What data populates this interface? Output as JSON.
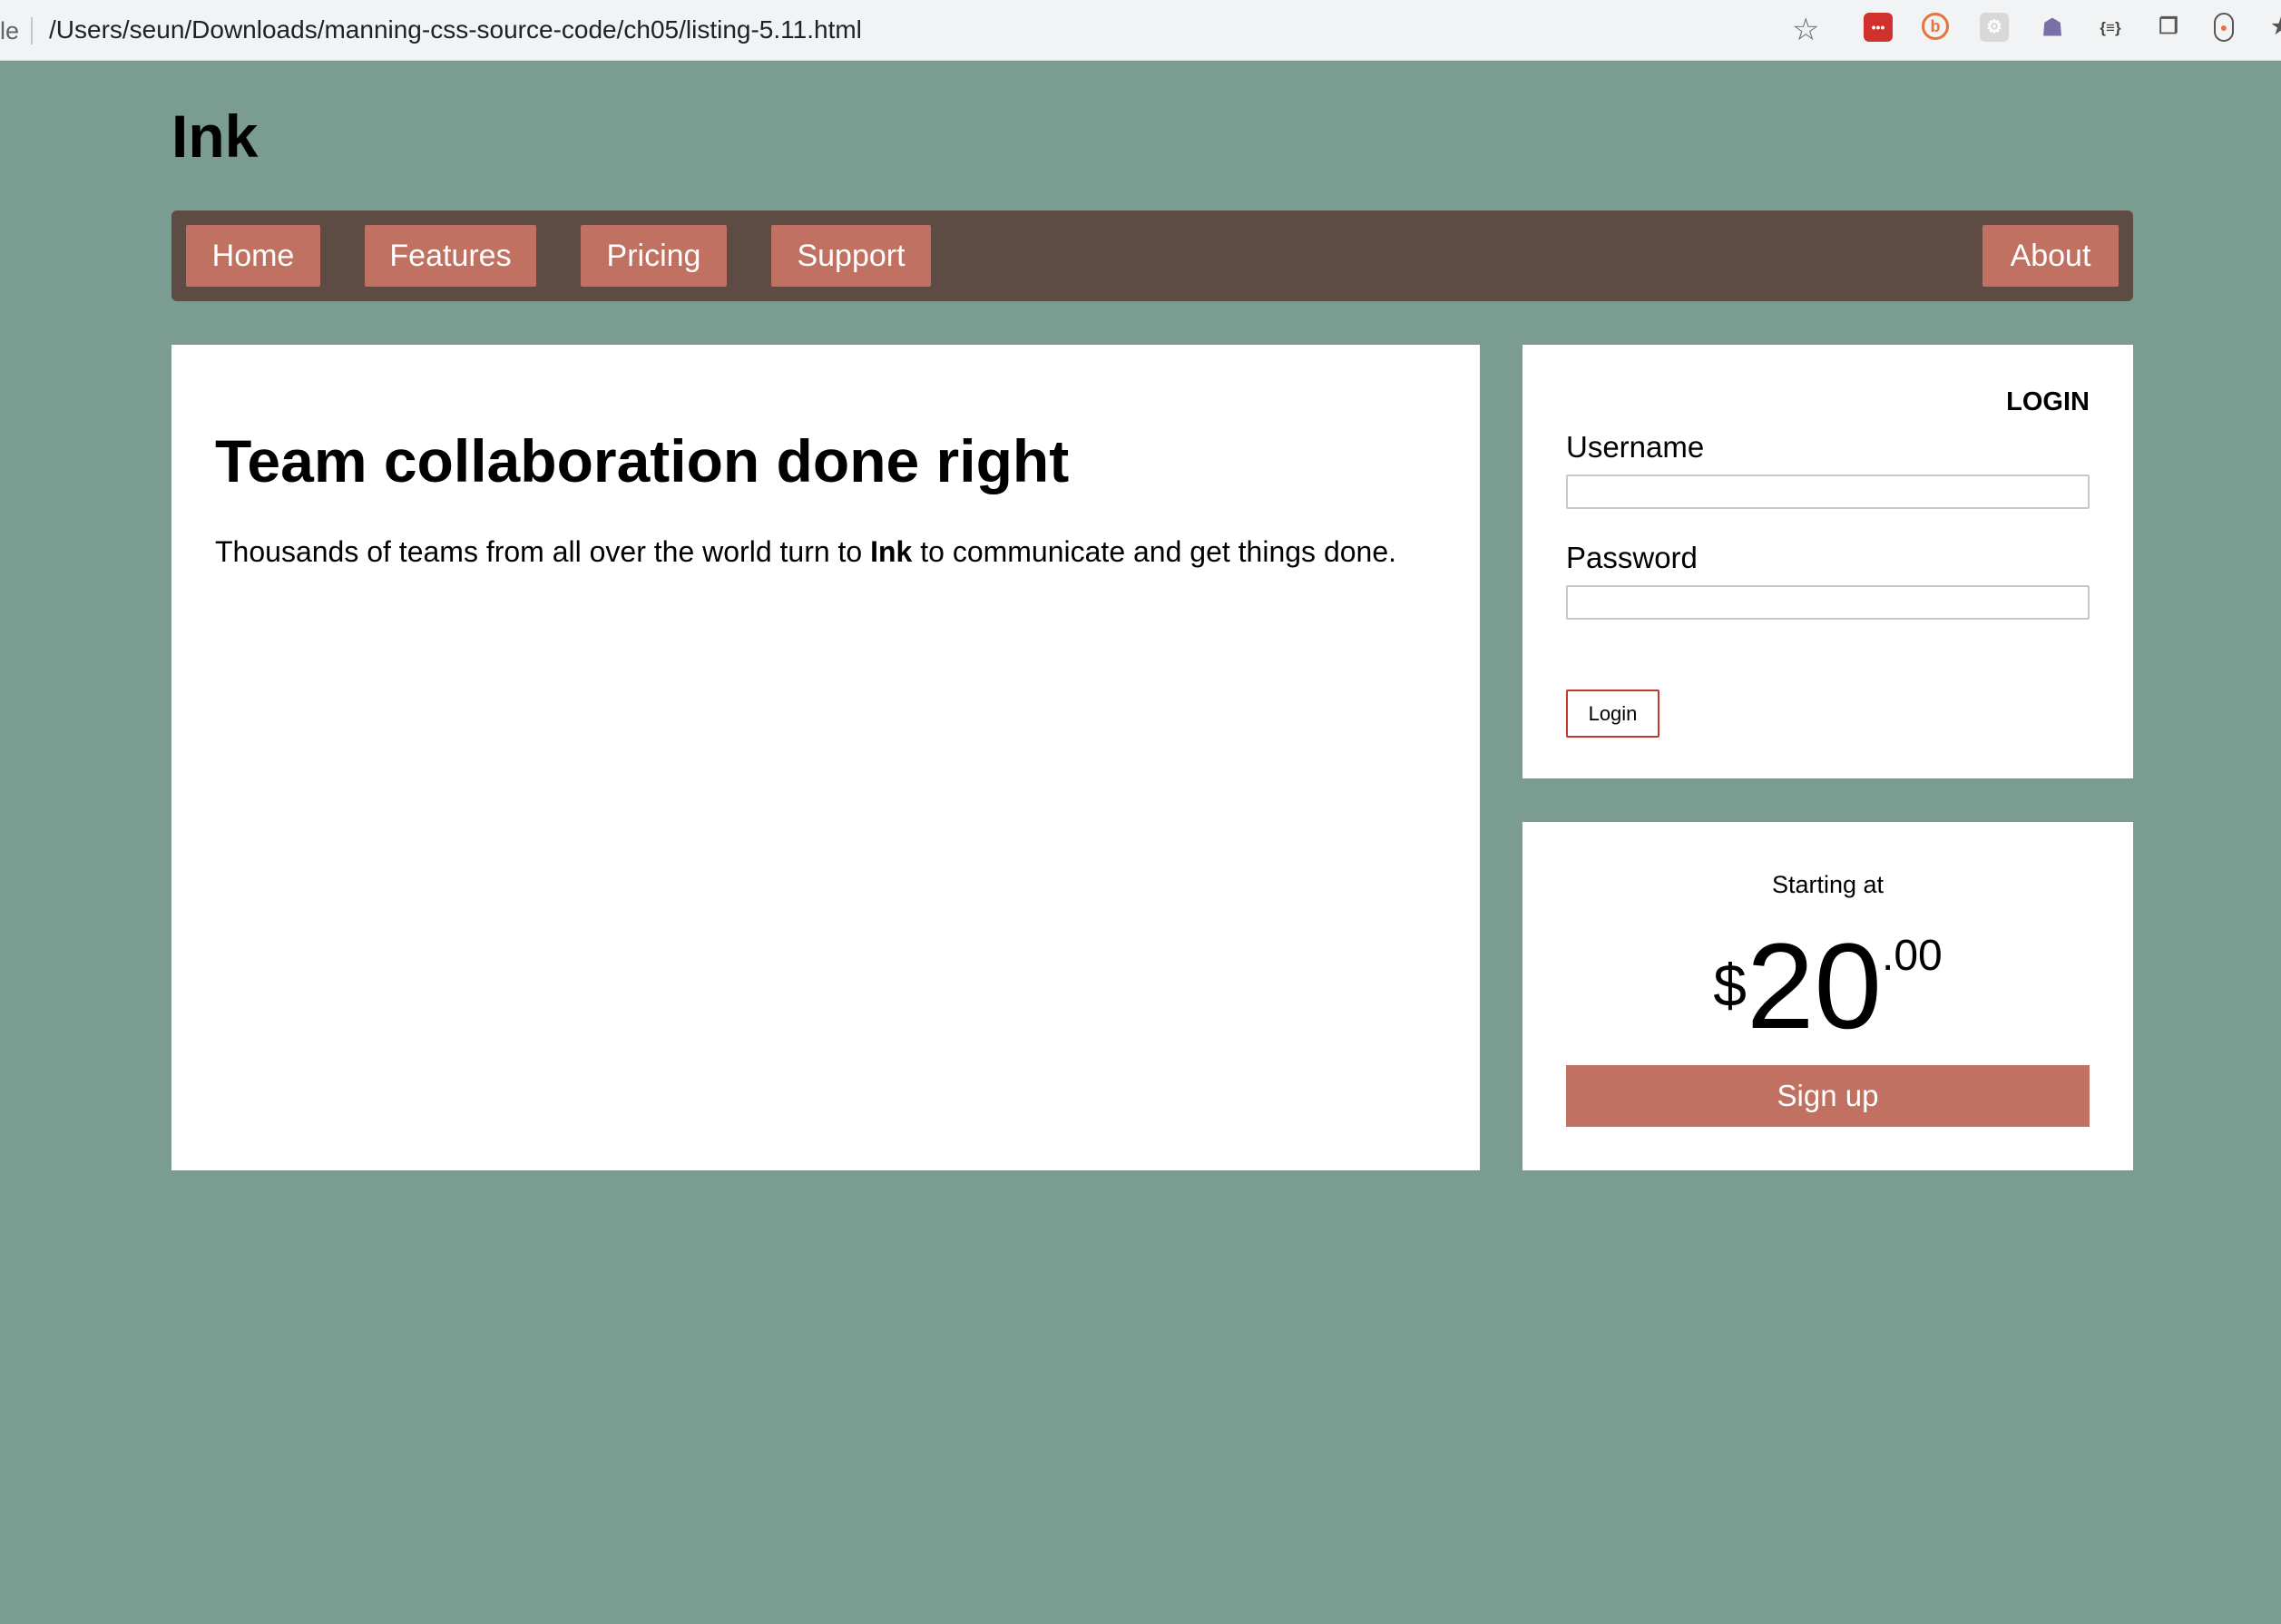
{
  "browser": {
    "url_prefix": "le",
    "url": "/Users/seun/Downloads/manning-css-source-code/ch05/listing-5.11.html",
    "star_icon": "star-icon",
    "extension_icons": [
      "lastpass-icon",
      "brave-icon",
      "gear-extension-icon",
      "octocat-icon",
      "json-icon",
      "windows-icon",
      "pill-icon",
      "puzzle-icon"
    ]
  },
  "site": {
    "brand": "Ink",
    "nav": {
      "home": "Home",
      "features": "Features",
      "pricing": "Pricing",
      "support": "Support",
      "about": "About"
    },
    "hero": {
      "title": "Team collaboration done right",
      "text_before": "Thousands of teams from all over the world turn to ",
      "text_bold": "Ink",
      "text_after": " to communicate and get things done."
    },
    "login": {
      "heading": "LOGIN",
      "username_label": "Username",
      "username_value": "",
      "password_label": "Password",
      "password_value": "",
      "button": "Login"
    },
    "pricing": {
      "starting_at": "Starting at",
      "currency": "$",
      "amount": "20",
      "cents": ".00",
      "signup": "Sign up"
    }
  },
  "colors": {
    "page_background": "#7a9c91",
    "navbar_background": "#5d4b44",
    "accent": "#c07162",
    "login_border": "#c0392b"
  }
}
